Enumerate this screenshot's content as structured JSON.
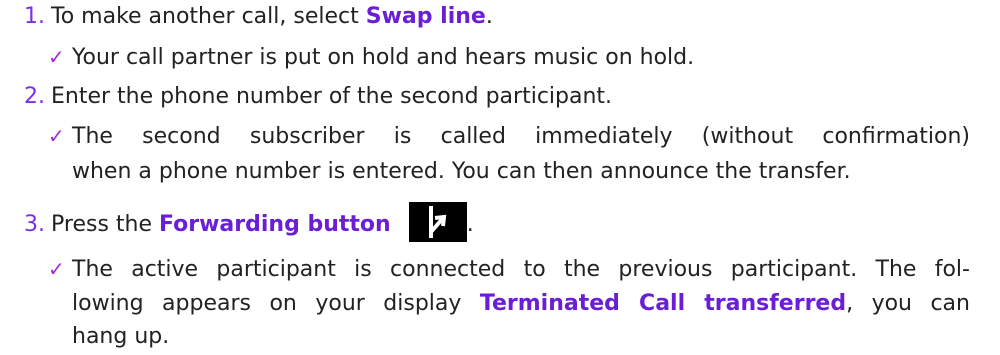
{
  "steps": [
    {
      "number": "1.",
      "text_before": "To make another call, select ",
      "bold": "Swap line",
      "text_after": ".",
      "result": "Your call partner is put on hold and hears music on hold."
    },
    {
      "number": "2.",
      "text": "Enter the phone number of the second participant.",
      "result_line1": "The second subscriber is called immediately (without confirmation)",
      "result_line2": "when a phone number is entered. You can then announce the transfer."
    },
    {
      "number": "3.",
      "text_before": "Press the ",
      "bold": "Forwarding button",
      "text_after": ".",
      "icon": "forward-arrow-icon",
      "result_line1": "The active participant is connected to the previous participant. The fol-",
      "result_line2_before": "lowing appears on your display ",
      "result_line2_bold": "Terminated Call transferred",
      "result_line2_after": ", you can",
      "result_line3": "hang up."
    }
  ],
  "check_symbol": "✓",
  "colors": {
    "accent": "#6a1fd6",
    "number": "#7a2ee6",
    "check": "#a02ad8",
    "text": "#222222"
  }
}
